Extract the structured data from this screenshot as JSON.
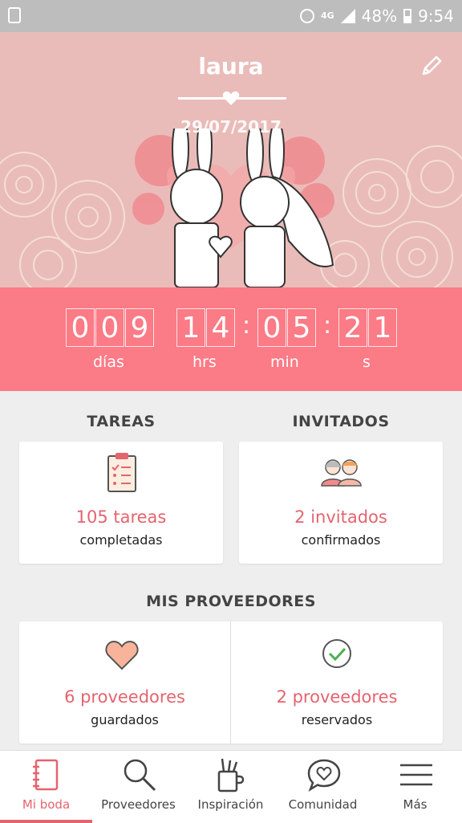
{
  "status_bar": {
    "network": "4G",
    "battery": "48%",
    "time": "9:54"
  },
  "hero": {
    "name": "laura",
    "date": "29/07/2017"
  },
  "countdown": {
    "days": [
      "0",
      "0",
      "9"
    ],
    "hours": [
      "1",
      "4"
    ],
    "minutes": [
      "0",
      "5"
    ],
    "seconds": [
      "2",
      "1"
    ],
    "labels": {
      "days": "días",
      "hours": "hrs",
      "minutes": "min",
      "seconds": "s"
    }
  },
  "tareas": {
    "title": "TAREAS",
    "count": "105 tareas",
    "status": "completadas"
  },
  "invitados": {
    "title": "INVITADOS",
    "count": "2 invitados",
    "status": "confirmados"
  },
  "proveedores": {
    "title": "MIS PROVEEDORES",
    "guardados": {
      "count": "6 proveedores",
      "status": "guardados"
    },
    "reservados": {
      "count": "2 proveedores",
      "status": "reservados"
    }
  },
  "nav": [
    {
      "label": "Mi boda",
      "icon": "notebook-icon",
      "active": true
    },
    {
      "label": "Proveedores",
      "icon": "search-icon",
      "active": false
    },
    {
      "label": "Inspiración",
      "icon": "pencil-cup-icon",
      "active": false
    },
    {
      "label": "Comunidad",
      "icon": "chat-heart-icon",
      "active": false
    },
    {
      "label": "Más",
      "icon": "menu-icon",
      "active": false
    }
  ],
  "colors": {
    "accent": "#e4646f",
    "countdown_bg": "#fb7b86",
    "hero_bg": "#e9bcb9"
  }
}
